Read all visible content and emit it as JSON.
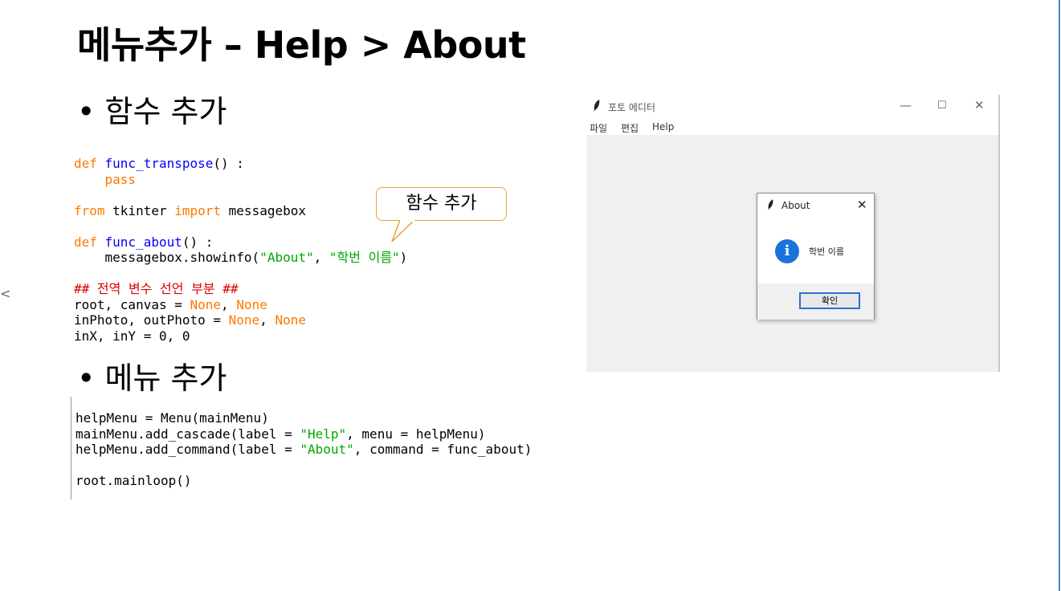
{
  "slide": {
    "title": "메뉴추가 – Help > About",
    "nav_prev": "<",
    "bullet1": "• 함수 추가",
    "bullet2": "• 메뉴 추가",
    "callout": "함수 추가"
  },
  "code1": {
    "l1_def": "def ",
    "l1_fn": "func_transpose",
    "l1_rest": "() :",
    "l2_kw": "    pass",
    "l4_kw1": "from",
    "l4_mid": " tkinter ",
    "l4_kw2": "import",
    "l4_end": " messagebox",
    "l6_def": "def ",
    "l6_fn": "func_about",
    "l6_rest": "() :",
    "l7_a": "    messagebox.showinfo(",
    "l7_s1": "\"About\"",
    "l7_b": ", ",
    "l7_s2": "\"학번 이름\"",
    "l7_c": ")",
    "l9_cm": "## 전역 변수 선언 부분 ##",
    "l10_a": "root, canvas = ",
    "l10_n1": "None",
    "l10_b": ", ",
    "l10_n2": "None",
    "l11_a": "inPhoto, outPhoto = ",
    "l11_n1": "None",
    "l11_b": ", ",
    "l11_n2": "None",
    "l12": "inX, inY = 0, 0"
  },
  "code2": {
    "l1": "helpMenu = Menu(mainMenu)",
    "l2_a": "mainMenu.add_cascade(label = ",
    "l2_s": "\"Help\"",
    "l2_b": ", menu = helpMenu)",
    "l3_a": "helpMenu.add_command(label = ",
    "l3_s": "\"About\"",
    "l3_b": ", command = func_about)",
    "l5": "root.mainloop()"
  },
  "window": {
    "title": "포토 에디터",
    "minimize": "—",
    "maximize": "☐",
    "close": "✕",
    "menu": [
      "파일",
      "편집",
      "Help"
    ]
  },
  "dialog": {
    "title": "About",
    "close": "✕",
    "info_icon": "i",
    "message": "학번 이름",
    "ok_label": "확인"
  },
  "icons": {
    "feather": "feather-icon",
    "info": "info-icon"
  },
  "colors": {
    "keyword": "#ff7700",
    "function": "#0000ff",
    "string": "#00aa00",
    "comment": "#dd0000",
    "callout_border": "#e8a23c",
    "info_blue": "#1a73d9"
  }
}
